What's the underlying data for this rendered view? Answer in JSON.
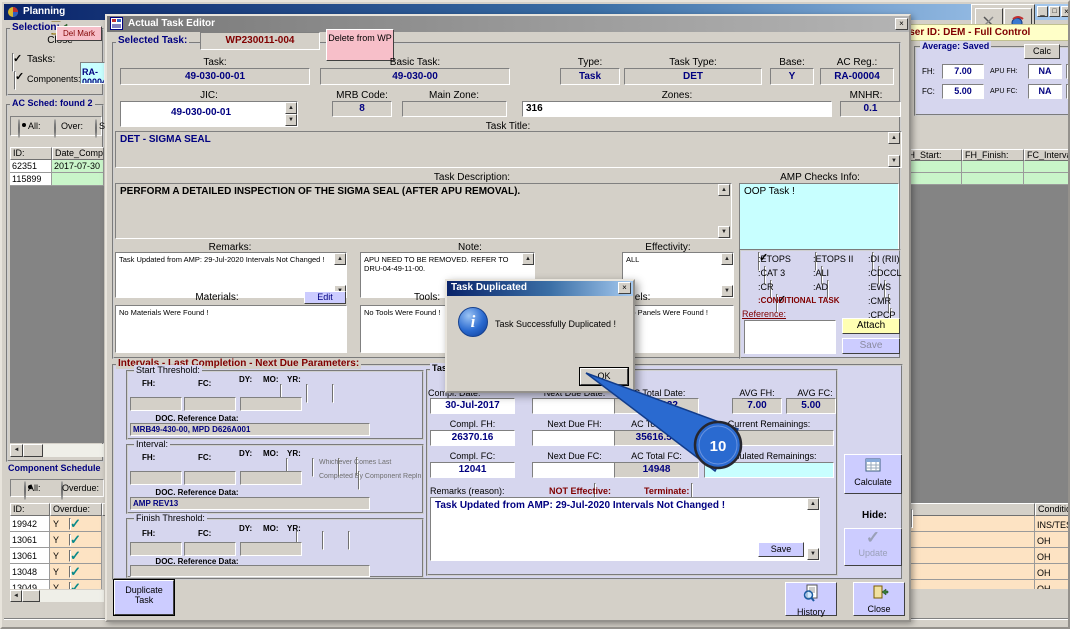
{
  "planning": {
    "title": "Planning",
    "toolbar": {
      "close": "Close"
    },
    "user_bar": "User ID: DEM - Full Control",
    "selection": {
      "label": "Selection:",
      "del_mark": "Del Mark",
      "tasks": "Tasks:",
      "tasks_checked": true,
      "components": "Components:",
      "components_checked": true,
      "reg": "RA-00004"
    },
    "ac_sched": {
      "label": "AC Sched: found 2",
      "radio_all": "All:",
      "radio_over": "Over:",
      "radio_sched": "Sched:",
      "col_id": "ID:",
      "col_date": "Date_Complete:",
      "rows": [
        {
          "id": "62351",
          "date": "2017-07-30"
        },
        {
          "id": "115899",
          "date": ""
        }
      ]
    },
    "flight_grid": {
      "col1": "FH_Start:",
      "col2": "FH_Finish:",
      "col3": "FC_Interval:"
    },
    "average": {
      "label": "Average: Saved",
      "calc": "Calc",
      "fh_label": "FH:",
      "fh": "7.00",
      "apu_fh_label": "APU FH:",
      "apu_fh": "NA",
      "fc_label": "FC:",
      "fc": "5.00",
      "apu_fc_label": "APU FC:",
      "apu_fc": "NA"
    },
    "component_schedule": {
      "label": "Component Schedule",
      "radio_all": "All:",
      "radio_overdue": "Overdue:",
      "col_id": "ID:",
      "col_overdue": "Overdue:",
      "col_condition": "Condition",
      "rows": [
        {
          "id": "19942",
          "overdue": "Y",
          "checked": true,
          "condition": "INS/TEST"
        },
        {
          "id": "13061",
          "overdue": "Y",
          "checked": true,
          "condition": "OH"
        },
        {
          "id": "13061",
          "overdue": "Y",
          "checked": true,
          "condition": "OH"
        },
        {
          "id": "13048",
          "overdue": "Y",
          "checked": true,
          "condition": "OH"
        },
        {
          "id": "13049",
          "overdue": "Y",
          "checked": true,
          "condition": "OH"
        }
      ]
    }
  },
  "editor": {
    "title": "Actual Task Editor",
    "selected_task_label": "Selected Task:",
    "selected_task": "WP230011-004",
    "delete_from_wp": "Delete from WP",
    "task_label": "Task:",
    "task": "49-030-00-01",
    "basic_task_label": "Basic Task:",
    "basic_task": "49-030-00",
    "type_label": "Type:",
    "type": "Task",
    "task_type_label": "Task Type:",
    "task_type": "DET",
    "base_label": "Base:",
    "base": "Y",
    "ac_reg_label": "AC Reg.:",
    "ac_reg": "RA-00004",
    "jic_label": "JIC:",
    "jic": "49-030-00-01",
    "mrb_label": "MRB Code:",
    "mrb": "8",
    "main_zone_label": "Main Zone:",
    "main_zone": "",
    "zones_label": "Zones:",
    "zones": "316",
    "mnhr_label": "MNHR:",
    "mnhr": "0.1",
    "task_title_label": "Task Title:",
    "task_title": "DET - SIGMA SEAL",
    "task_description_label": "Task Description:",
    "task_description": "PERFORM A DETAILED INSPECTION OF THE SIGMA SEAL (AFTER APU REMOVAL).",
    "amp_checks_label": "AMP Checks Info:",
    "amp_checks": "OOP Task !",
    "remarks_label": "Remarks:",
    "remarks": "Task Updated from AMP: 29-Jul-2020 Intervals Not Changed !",
    "note_label": "Note:",
    "note": "APU NEED TO BE REMOVED. REFER TO DRU-04-49-11-00.",
    "effectivity_label": "Effectivity:",
    "effectivity": "ALL",
    "materials_label": "Materials:",
    "edit_btn": "Edit",
    "materials": "No Materials Were Found !",
    "tools_label": "Tools:",
    "tools": "No Tools Were Found !",
    "panels_label": "Panels:",
    "panels": "No Panels Were Found !",
    "checks": {
      "items": [
        {
          "label": ":ETOPS",
          "checked": true
        },
        {
          "label": ":ETOPS II",
          "checked": false
        },
        {
          "label": ":DI (RII)",
          "checked": false
        },
        {
          "label": ":CAT 3",
          "checked": false
        },
        {
          "label": ":ALI",
          "checked": false
        },
        {
          "label": ":CDCCL",
          "checked": false
        },
        {
          "label": ":CR",
          "checked": false
        },
        {
          "label": ":AD",
          "checked": false
        },
        {
          "label": ":EWS",
          "checked": false
        },
        {
          "label": ":CONDITIONAL TASK",
          "checked": true
        },
        {
          "label": ":CMR",
          "checked": false
        },
        {
          "label": ":CPCP",
          "checked": false
        }
      ],
      "reference_label": "Reference:",
      "attach": "Attach",
      "save": "Save"
    },
    "intervals": {
      "label": "Intervals - Last Completion - Next Due Parameters:",
      "fh": "FH:",
      "fc": "FC:",
      "dy": "DY:",
      "mo": "MO:",
      "yr": "YR:",
      "doc_label": "DOC. Reference Data:",
      "groups": [
        {
          "name": "Start Threshold:",
          "doc": "MRB49-430-00, MPD D626A001"
        },
        {
          "name": "Interval:",
          "doc": "AMP REV13",
          "whichever": "Whichever Comes Last",
          "completed_by": "Completed By Component Repln."
        },
        {
          "name": "Finish Threshold:",
          "doc": ""
        }
      ]
    },
    "completion": {
      "label": "Task Completion:",
      "compl_date_label": "Compl. Date:",
      "compl_date": "30-Jul-2017",
      "next_due_date_label": "Next Due Date:",
      "next_due_date": "",
      "ac_total_date_label": "AC Total Date:",
      "ac_total_date": "Apr-2022",
      "avg_fh_label": "AVG FH:",
      "avg_fh": "7.00",
      "avg_fc_label": "AVG FC:",
      "avg_fc": "5.00",
      "compl_fh_label": "Compl. FH:",
      "compl_fh": "26370.16",
      "next_due_fh_label": "Next Due FH:",
      "next_due_fh": "",
      "ac_total_fh_label": "AC Total FH:",
      "ac_total_fh": "35616.53",
      "current_rem_label": "Current Remainings:",
      "current_rem": "",
      "compl_fc_label": "Compl. FC:",
      "compl_fc": "12041",
      "next_due_fc_label": "Next Due FC:",
      "next_due_fc": "",
      "ac_total_fc_label": "AC Total FC:",
      "ac_total_fc": "14948",
      "calc_rem_label": "Calculated Remainings:",
      "calc_rem": "",
      "remarks_reason_label": "Remarks (reason):",
      "not_effective": "NOT Effective:",
      "terminate": "Terminate:",
      "remarks_reason": "Task Updated from AMP: 29-Jul-2020 Intervals Not Changed !",
      "save": "Save"
    },
    "hide_label": "Hide:",
    "update": "Update",
    "calculate": "Calculate",
    "duplicate_task": "Duplicate Task",
    "history": "History",
    "close_btn": "Close"
  },
  "dialog": {
    "title": "Task Duplicated",
    "message": "Task Successfully Duplicated !",
    "ok": "OK"
  },
  "annotation": {
    "step": "10"
  },
  "colors": {
    "accent_blue": "#2a6ad0",
    "yellow_bar": "#ffffc8",
    "green_cell": "#c9f5c9",
    "peach_cell": "#fde3c3",
    "cyan_field": "#c8ffff",
    "lavender": "#ccccff"
  }
}
